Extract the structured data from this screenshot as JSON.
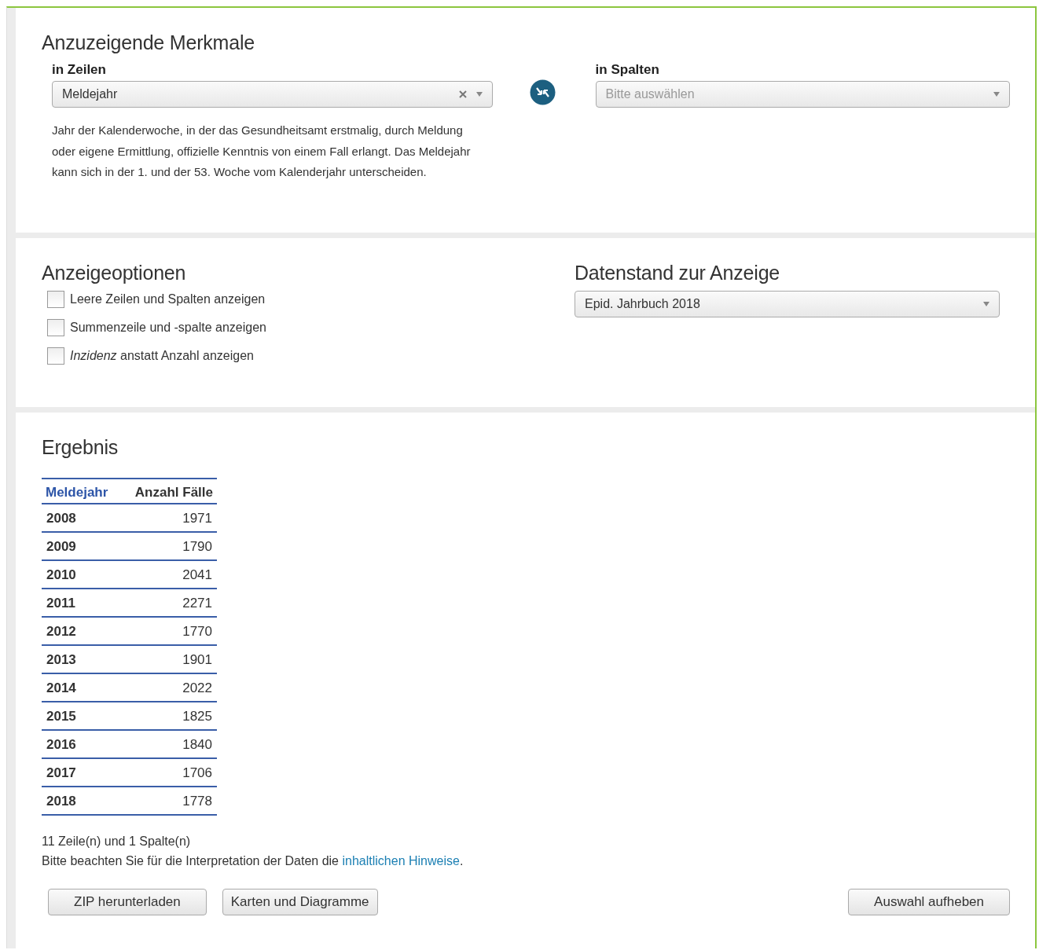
{
  "features": {
    "title": "Anzuzeigende Merkmale",
    "rows": {
      "label": "in Zeilen",
      "value": "Meldejahr",
      "clearable": true
    },
    "columns": {
      "label": "in Spalten",
      "placeholder": "Bitte auswählen"
    },
    "description": "Jahr der Kalenderwoche, in der das Gesundheitsamt erstmalig, durch Meldung oder eigene Ermittlung, offizielle Kenntnis von einem Fall erlangt. Das Meldejahr kann sich in der 1. und der 53. Woche vom Kalenderjahr unterscheiden."
  },
  "options": {
    "title": "Anzeigeoptionen",
    "checkboxes": [
      {
        "label": "Leere Zeilen und Spalten anzeigen",
        "checked": false
      },
      {
        "label": "Summenzeile und -spalte anzeigen",
        "checked": false
      },
      {
        "label": "*Inzidenz* anstatt Anzahl anzeigen",
        "checked": false
      }
    ]
  },
  "data_state": {
    "title": "Datenstand zur Anzeige",
    "value": "Epid. Jahrbuch 2018"
  },
  "result": {
    "title": "Ergebnis",
    "table": {
      "columns": [
        "Meldejahr",
        "Anzahl Fälle"
      ],
      "rows": [
        [
          "2008",
          "1971"
        ],
        [
          "2009",
          "1790"
        ],
        [
          "2010",
          "2041"
        ],
        [
          "2011",
          "2271"
        ],
        [
          "2012",
          "1770"
        ],
        [
          "2013",
          "1901"
        ],
        [
          "2014",
          "2022"
        ],
        [
          "2015",
          "1825"
        ],
        [
          "2016",
          "1840"
        ],
        [
          "2017",
          "1706"
        ],
        [
          "2018",
          "1778"
        ]
      ]
    },
    "summary": "11 Zeile(n) und 1 Spalte(n)",
    "note": {
      "text": "Bitte beachten Sie für die Interpretation der Daten die ",
      "link": "inhaltlichen Hinweise",
      "end": "."
    },
    "buttons": [
      "ZIP herunterladen",
      "Karten und Diagramme"
    ],
    "reset_button": "Auswahl aufheben"
  }
}
